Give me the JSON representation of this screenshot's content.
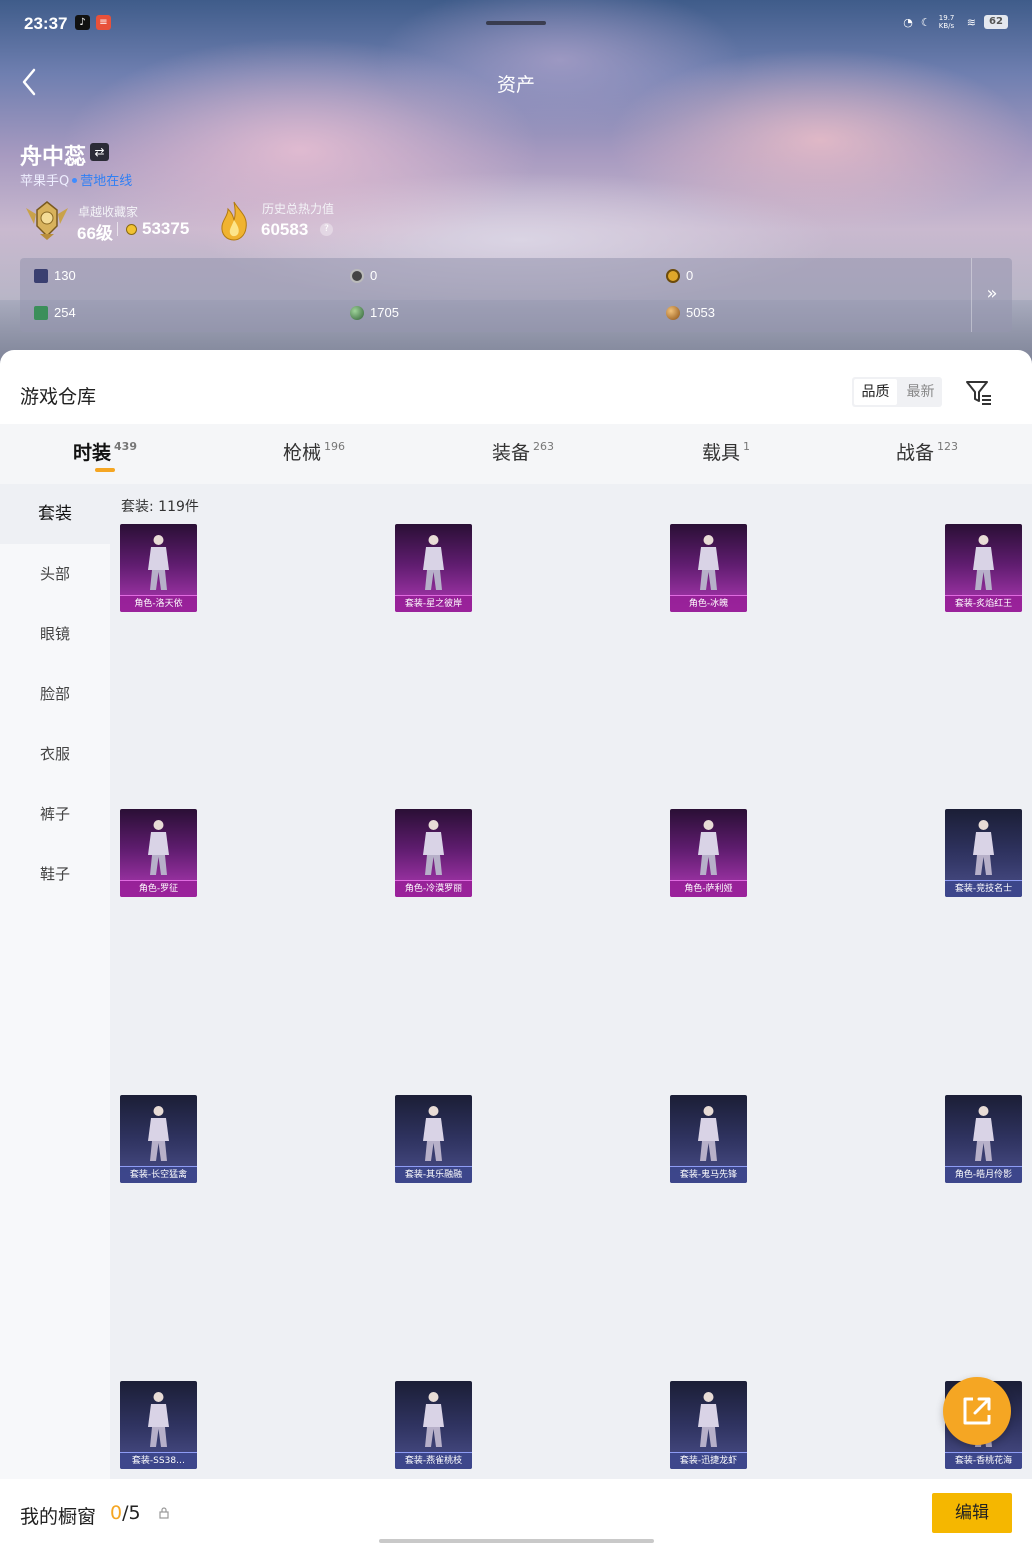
{
  "status_bar": {
    "time": "23:37",
    "network_speed": "19.7 KB/s",
    "battery": "62"
  },
  "header": {
    "title": "资产"
  },
  "player": {
    "name": "舟中蕊",
    "platform": "苹果手Q",
    "status": "营地在线",
    "rank_caption": "卓越收藏家",
    "rank_level": "66级",
    "coins": "53375",
    "heat_caption": "历史总热力值",
    "heat_value": "60583",
    "help": "?"
  },
  "currencies": [
    {
      "icon": "card-icon",
      "value": "130"
    },
    {
      "icon": "dark-coin-icon",
      "value": "0"
    },
    {
      "icon": "gold-coin-icon",
      "value": "0"
    },
    {
      "icon": "green-gem-icon",
      "value": "254"
    },
    {
      "icon": "globe-icon",
      "value": "1705"
    },
    {
      "icon": "bronze-coin-icon",
      "value": "5053"
    }
  ],
  "currency_more": "»",
  "warehouse": {
    "title": "游戏仓库",
    "sort_options": [
      "品质",
      "最新"
    ],
    "active_sort": "品质"
  },
  "tabs": [
    {
      "label": "时装",
      "count": "439"
    },
    {
      "label": "枪械",
      "count": "196"
    },
    {
      "label": "装备",
      "count": "263"
    },
    {
      "label": "载具",
      "count": "1"
    },
    {
      "label": "战备",
      "count": "123"
    }
  ],
  "sidebar": [
    "套装",
    "头部",
    "眼镜",
    "脸部",
    "衣服",
    "裤子",
    "鞋子"
  ],
  "count_label": "套装: 119件",
  "items": [
    {
      "label": "角色-洛天依",
      "tier": "purple"
    },
    {
      "label": "套装-星之彼岸",
      "tier": "purple"
    },
    {
      "label": "角色-冰魄",
      "tier": "purple"
    },
    {
      "label": "套装-炙焰红王",
      "tier": "purple"
    },
    {
      "label": "角色-罗征",
      "tier": "purple"
    },
    {
      "label": "角色-冷漠罗丽",
      "tier": "purple"
    },
    {
      "label": "角色-萨利娅",
      "tier": "purple"
    },
    {
      "label": "套装-竞技名士",
      "tier": "blue"
    },
    {
      "label": "套装-长空猛禽",
      "tier": "blue"
    },
    {
      "label": "套装-其乐融融",
      "tier": "blue"
    },
    {
      "label": "套装-鬼马先锋",
      "tier": "blue"
    },
    {
      "label": "角色-皓月伶影",
      "tier": "blue"
    },
    {
      "label": "套装-SS38…",
      "tier": "blue"
    },
    {
      "label": "套装-燕雀桃枝",
      "tier": "blue"
    },
    {
      "label": "套装-迅捷龙虾",
      "tier": "blue"
    },
    {
      "label": "套装-香桃花海",
      "tier": "blue"
    }
  ],
  "showcase": {
    "title": "我的橱窗",
    "used": "0",
    "total": "/5",
    "edit": "编辑"
  },
  "colors": {
    "accent": "#f5a623",
    "edit_button": "#f5b700",
    "online": "#2f7ff5"
  }
}
